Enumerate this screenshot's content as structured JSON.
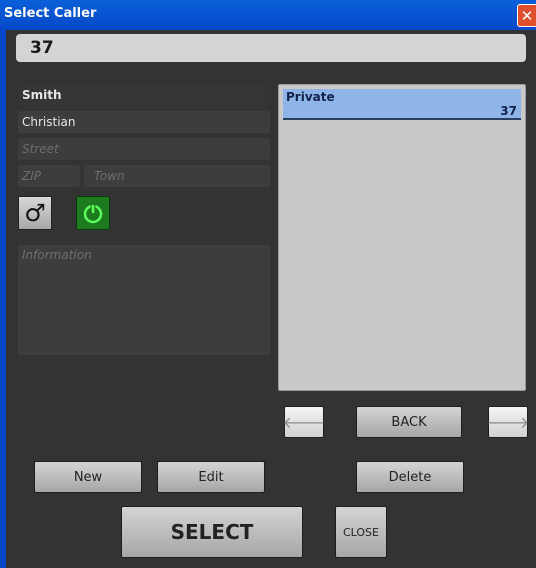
{
  "window": {
    "title": "Select Caller",
    "close_label": "✕"
  },
  "caller_number": "37",
  "contact": {
    "last_name": "Smith",
    "first_name": "Christian",
    "street_placeholder": "Street",
    "zip_placeholder": "ZIP",
    "town_placeholder": "Town",
    "information_placeholder": "Information",
    "gender_icon": "♂",
    "power_icon": "power-icon"
  },
  "numbers_list": [
    {
      "type": "Private",
      "number": "37"
    }
  ],
  "nav": {
    "prev_label": "🡐",
    "back_label": "BACK",
    "next_label": "🡒"
  },
  "actions": {
    "new_label": "New",
    "edit_label": "Edit",
    "delete_label": "Delete",
    "select_label": "SELECT",
    "close_label": "CLOSE"
  },
  "colors": {
    "titlebar": "#0648c9",
    "selected_row": "#8fb4e8",
    "power_green": "#1e7a1e"
  }
}
